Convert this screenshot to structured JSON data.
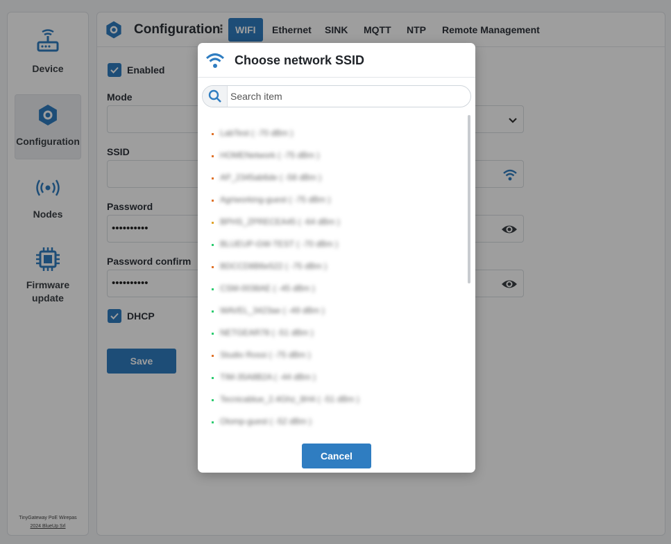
{
  "sidebar": {
    "items": [
      {
        "label": "Device"
      },
      {
        "label": "Configuration"
      },
      {
        "label": "Nodes"
      },
      {
        "label": "Firmware update"
      }
    ],
    "footer": {
      "product": "TinyGateway PoE Wirepas",
      "copyright": "2024 BlueUp Srl"
    }
  },
  "header": {
    "title": "Configuration",
    "tabs": [
      {
        "label": "WIFI"
      },
      {
        "label": "Ethernet"
      },
      {
        "label": "SINK"
      },
      {
        "label": "MQTT"
      },
      {
        "label": "NTP"
      },
      {
        "label": "Remote Management"
      }
    ]
  },
  "form": {
    "enabled_label": "Enabled",
    "mode_label": "Mode",
    "ssid_label": "SSID",
    "password_label": "Password",
    "password_value": "••••••••••",
    "password_confirm_label": "Password confirm",
    "password_confirm_value": "••••••••••",
    "dhcp_label": "DHCP",
    "save_label": "Save"
  },
  "modal": {
    "title": "Choose network SSID",
    "search_placeholder": "Search item",
    "ssids": [
      {
        "name": "LabTest ( -70 dBm )",
        "signal_color": "#e0742c"
      },
      {
        "name": "HOMENetwork ( -75 dBm )",
        "signal_color": "#e0742c"
      },
      {
        "name": "AP_2345ab6de ( -58 dBm )",
        "signal_color": "#e0742c"
      },
      {
        "name": "Agriworking-guest ( -75 dBm )",
        "signal_color": "#e0742c"
      },
      {
        "name": "BPHS_ZPRECEA45 ( -64 dBm )",
        "signal_color": "#e0a42c"
      },
      {
        "name": "BLUEUP-GW-TEST ( -70 dBm )",
        "signal_color": "#2ecc71"
      },
      {
        "name": "BDCCD8B6e522 ( -75 dBm )",
        "signal_color": "#e0742c"
      },
      {
        "name": "CSM-0038AE ( -45 dBm )",
        "signal_color": "#2ecc71"
      },
      {
        "name": "WAVEL_3423ae ( -49 dBm )",
        "signal_color": "#2ecc71"
      },
      {
        "name": "NETGEAR78 ( -51 dBm )",
        "signal_color": "#2ecc71"
      },
      {
        "name": "Studio Rossi ( -75 dBm )",
        "signal_color": "#e0742c"
      },
      {
        "name": "TIM-35A8B2A ( -44 dBm )",
        "signal_color": "#2ecc71"
      },
      {
        "name": "Tecnicablue_2.4Ghz_8H4 ( -51 dBm )",
        "signal_color": "#2ecc71"
      },
      {
        "name": "Olomp-guest ( -52 dBm )",
        "signal_color": "#2ecc71"
      }
    ],
    "cancel_label": "Cancel"
  },
  "colors": {
    "accent": "#2f7dc1",
    "overlay": "rgba(0,0,0,0.38)"
  }
}
